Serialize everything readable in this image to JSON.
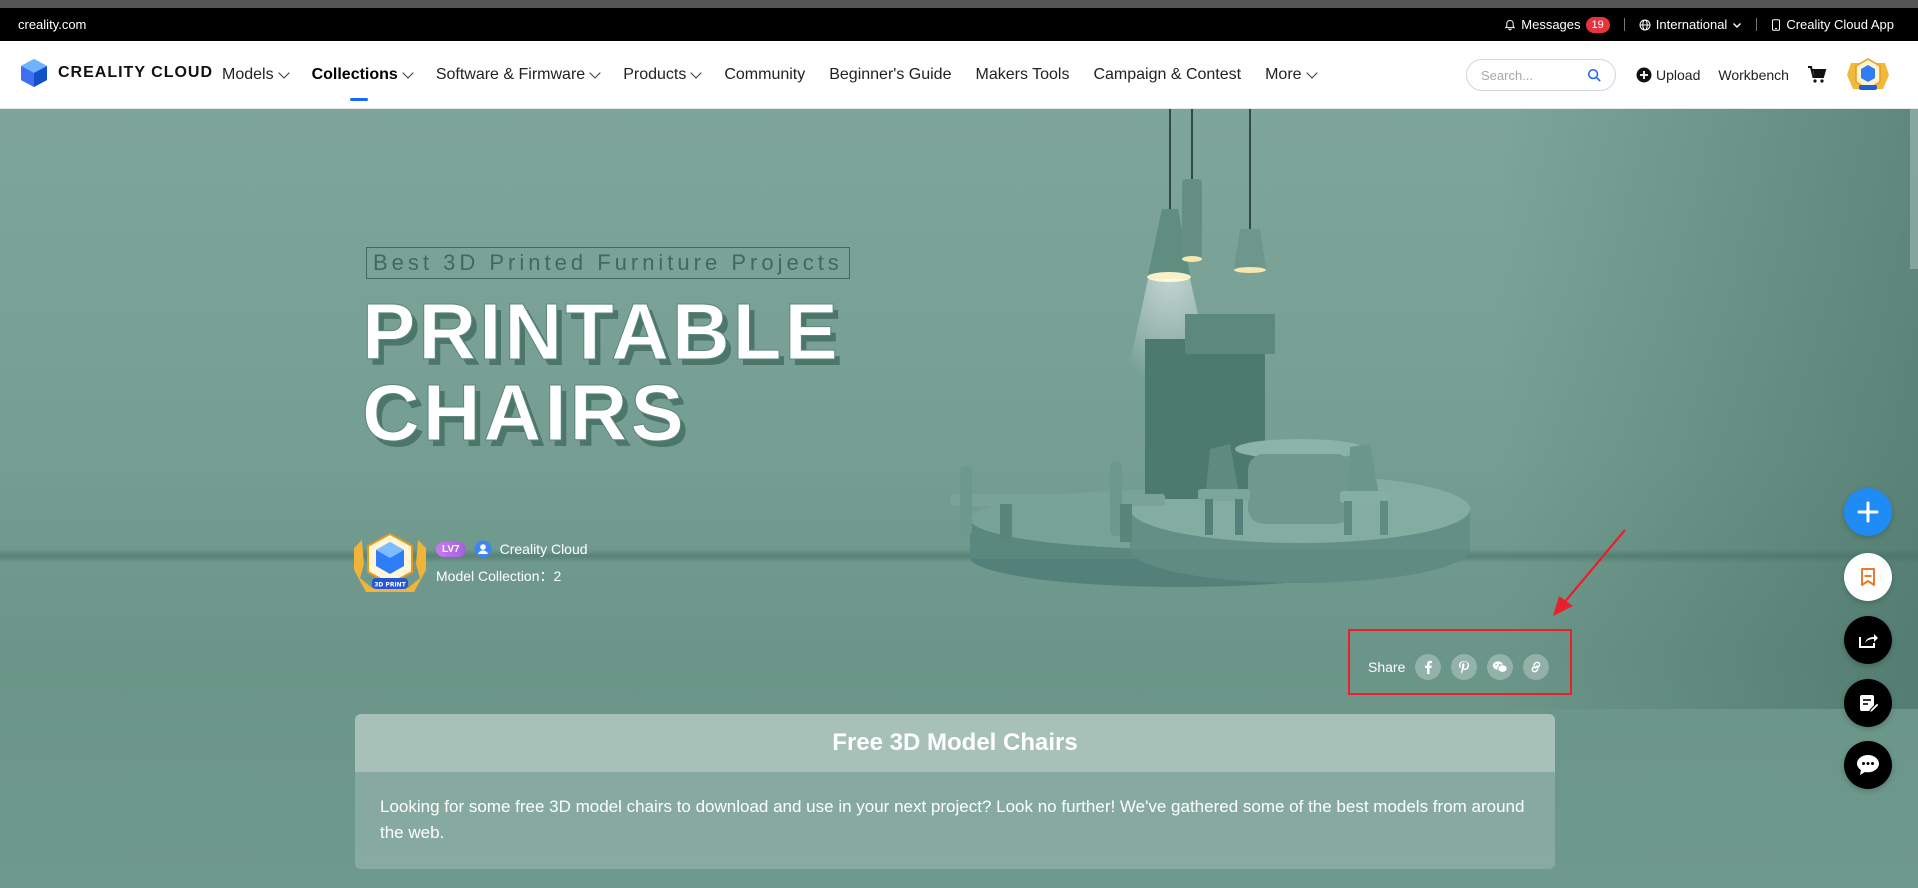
{
  "topbar": {
    "domain": "creality.com",
    "messages_label": "Messages",
    "messages_count": "19",
    "language_label": "International",
    "app_label": "Creality Cloud App"
  },
  "nav": {
    "logo_text": "CREALITY CLOUD",
    "items": [
      {
        "label": "Models",
        "dropdown": true
      },
      {
        "label": "Collections",
        "dropdown": true,
        "active": true
      },
      {
        "label": "Software & Firmware",
        "dropdown": true
      },
      {
        "label": "Products",
        "dropdown": true
      },
      {
        "label": "Community"
      },
      {
        "label": "Beginner's Guide"
      },
      {
        "label": "Makers Tools"
      },
      {
        "label": "Campaign & Contest"
      },
      {
        "label": "More",
        "dropdown": true
      }
    ],
    "search_placeholder": "Search...",
    "upload_label": "Upload",
    "workbench_label": "Workbench"
  },
  "hero": {
    "tagline": "Best 3D Printed Furniture Projects",
    "title_line1": "PRINTABLE",
    "title_line2": "CHAIRS"
  },
  "author": {
    "level": "LV7",
    "name": "Creality Cloud",
    "collection_label": "Model Collection：",
    "collection_count": "2",
    "badge_text": "3D PRINT"
  },
  "share": {
    "label": "Share",
    "icons": [
      "facebook-icon",
      "pinterest-icon",
      "wechat-icon",
      "link-icon"
    ]
  },
  "card": {
    "title": "Free 3D Model Chairs",
    "body": "Looking for some free 3D model chairs to download and use in your next project? Look no further! We've gathered some of the best models from around the web."
  },
  "colors": {
    "hero_bg": "#759e93",
    "accent_blue": "#1f8bf5",
    "highlight_red": "#e8202c",
    "badge_red": "#e8323c"
  }
}
